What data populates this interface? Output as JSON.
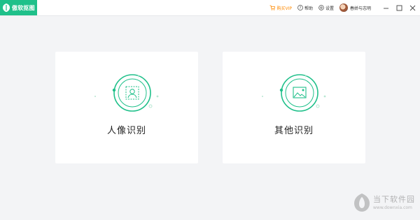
{
  "app": {
    "name": "傲软抠图"
  },
  "topbar": {
    "vip_label": "购买VIP",
    "help_label": "帮助",
    "settings_label": "设置",
    "username": "春娇与志明"
  },
  "cards": [
    {
      "label": "人像识别",
      "icon": "portrait-scan-icon"
    },
    {
      "label": "其他识别",
      "icon": "image-scan-icon"
    }
  ],
  "watermark": {
    "text": "当下软件园",
    "url": "www.downxia.com"
  },
  "colors": {
    "accent": "#1fc08a",
    "vip": "#ff8a00"
  }
}
